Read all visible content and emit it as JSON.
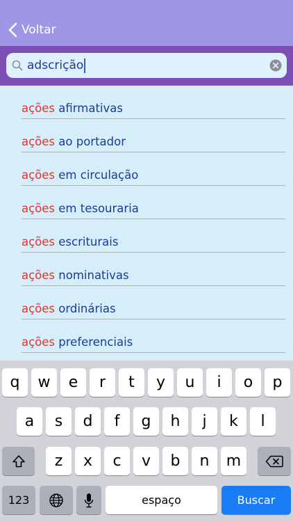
{
  "nav": {
    "back_label": "Voltar"
  },
  "search": {
    "value": "adscrição"
  },
  "results": [
    {
      "highlight": "ações",
      "rest": " afirmativas"
    },
    {
      "highlight": "ações",
      "rest": " ao portador"
    },
    {
      "highlight": "ações",
      "rest": " em circulação"
    },
    {
      "highlight": "ações",
      "rest": " em tesouraria"
    },
    {
      "highlight": "ações",
      "rest": " escriturais"
    },
    {
      "highlight": "ações",
      "rest": " nominativas"
    },
    {
      "highlight": "ações",
      "rest": " ordinárias"
    },
    {
      "highlight": "ações",
      "rest": " preferenciais"
    }
  ],
  "keyboard": {
    "row1": [
      "q",
      "w",
      "e",
      "r",
      "t",
      "y",
      "u",
      "i",
      "o",
      "p"
    ],
    "row2": [
      "a",
      "s",
      "d",
      "f",
      "g",
      "h",
      "j",
      "k",
      "l"
    ],
    "row3": [
      "z",
      "x",
      "c",
      "v",
      "b",
      "n",
      "m"
    ],
    "numbers_label": "123",
    "space_label": "espaço",
    "return_label": "Buscar",
    "shift_icon": "shift-icon",
    "delete_icon": "delete-icon",
    "globe_icon": "globe-icon",
    "mic_icon": "microphone-icon"
  },
  "colors": {
    "navbar": "#9f97e6",
    "search_band": "#7d4fb4",
    "background": "#d5eefa",
    "highlight_text": "#e0342f",
    "result_text": "#1c3b92",
    "return_key": "#1a7cf5"
  }
}
